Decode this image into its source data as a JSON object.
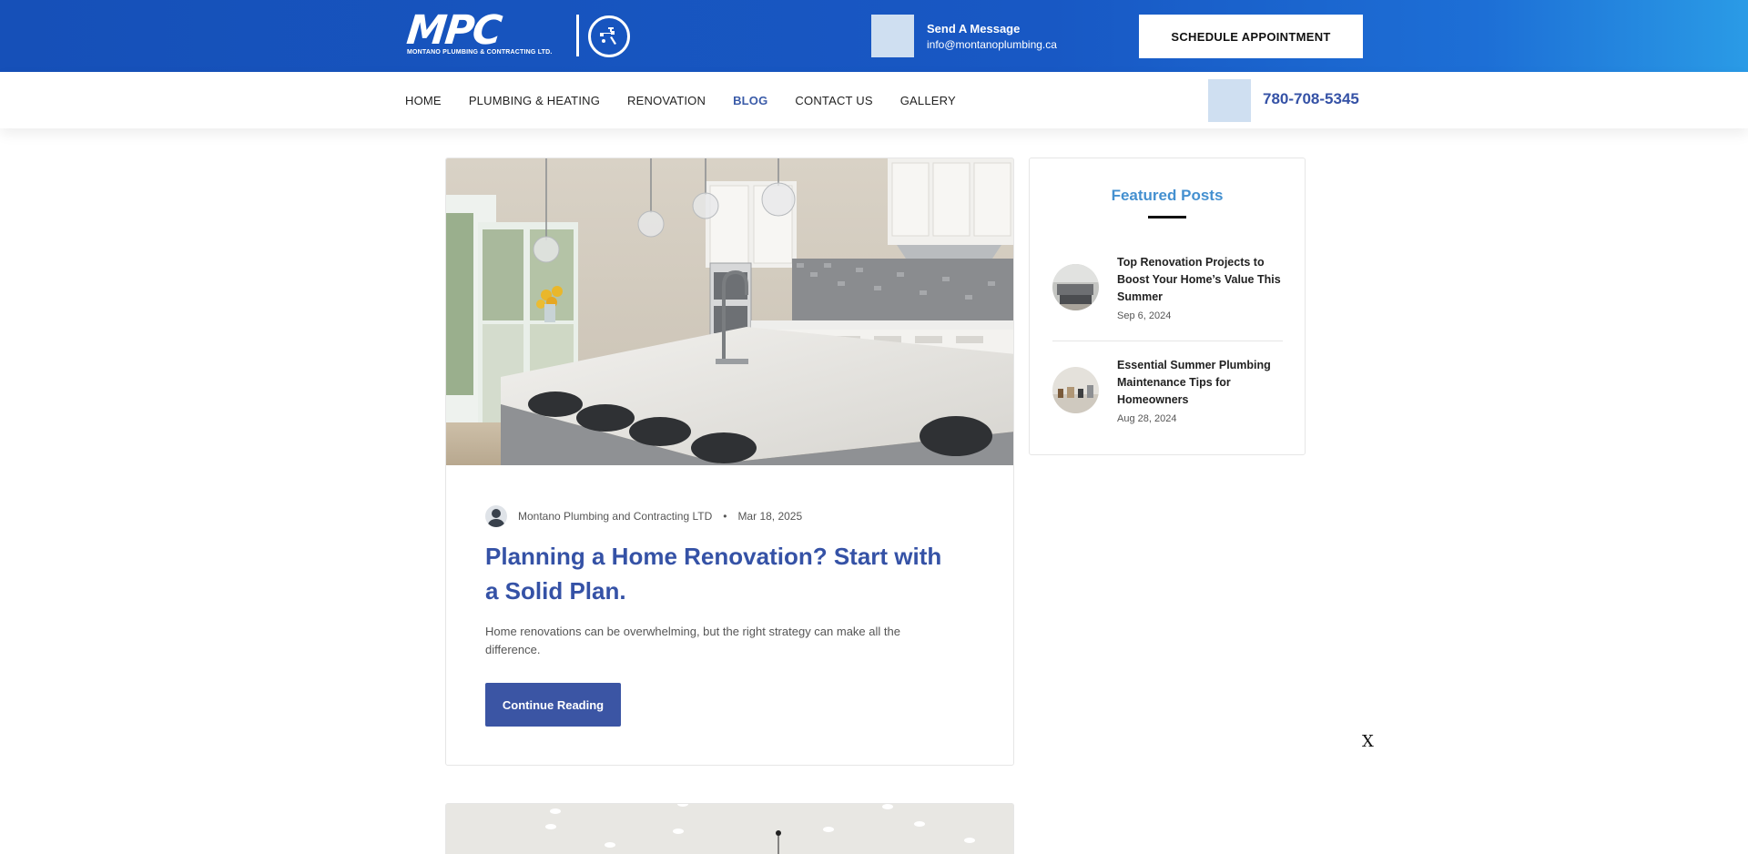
{
  "header": {
    "logo_text": "MPC",
    "logo_subtitle": "MONTANO PLUMBING & CONTRACTING LTD.",
    "message_title": "Send A Message",
    "message_email": "info@montanoplumbing.ca",
    "schedule_label": "SCHEDULE APPOINTMENT"
  },
  "nav": {
    "items": [
      {
        "label": "HOME"
      },
      {
        "label": "PLUMBING & HEATING"
      },
      {
        "label": "RENOVATION"
      },
      {
        "label": "BLOG"
      },
      {
        "label": "CONTACT US"
      },
      {
        "label": "GALLERY"
      }
    ],
    "active": "BLOG",
    "phone": "780-708-5345"
  },
  "post": {
    "author": "Montano Plumbing and Contracting LTD",
    "date": "Mar 18, 2025",
    "title": "Planning a Home Renovation? Start with a Solid Plan.",
    "excerpt": "Home renovations can be overwhelming, but the right strategy can make all the difference.",
    "button": "Continue Reading"
  },
  "sidebar": {
    "title": "Featured Posts",
    "posts": [
      {
        "title": "Top Renovation Projects to Boost Your Home’s Value This Summer",
        "date": "Sep 6, 2024"
      },
      {
        "title": "Essential Summer Plumbing Maintenance Tips for Homeowners",
        "date": "Aug 28, 2024"
      }
    ]
  },
  "close_label": "X",
  "colors": {
    "header_blue": "#1650b8",
    "accent_blue": "#3552a6",
    "featured_title": "#4490d0",
    "icon_placeholder": "#cfdff1"
  }
}
